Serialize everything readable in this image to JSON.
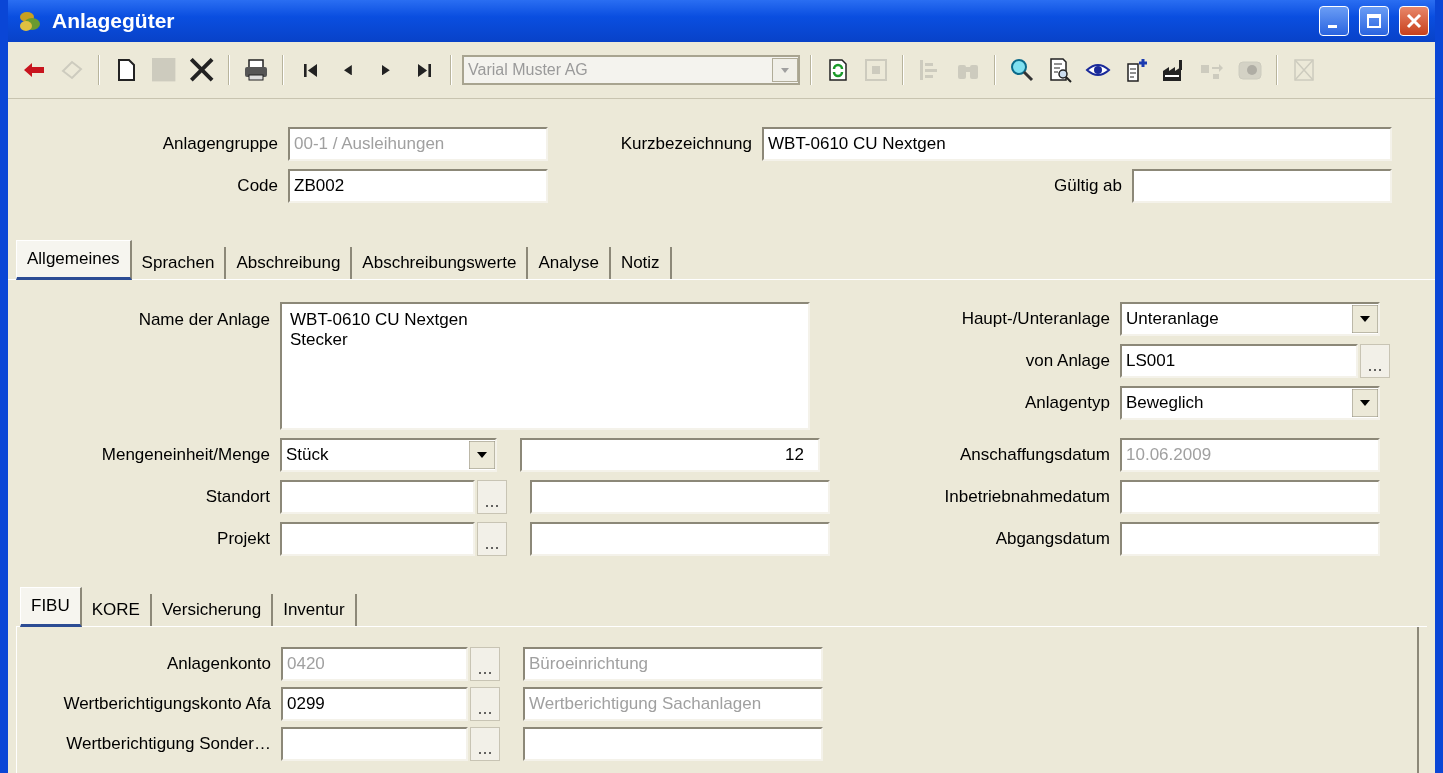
{
  "window": {
    "title": "Anlagegüter"
  },
  "toolbar": [
    {
      "kind": "back",
      "disabled": false
    },
    {
      "kind": "eraser",
      "disabled": true
    },
    {
      "kind": "separator"
    },
    {
      "kind": "new",
      "disabled": false
    },
    {
      "kind": "stop",
      "disabled": true
    },
    {
      "kind": "delete",
      "disabled": false
    },
    {
      "kind": "separator"
    },
    {
      "kind": "print",
      "disabled": false
    },
    {
      "kind": "separator"
    },
    {
      "kind": "first",
      "disabled": false
    },
    {
      "kind": "prev",
      "disabled": false
    },
    {
      "kind": "next",
      "disabled": false
    },
    {
      "kind": "last",
      "disabled": false
    },
    {
      "kind": "separator"
    },
    {
      "kind": "combo",
      "value": "Varial Muster AG",
      "disabled": true
    },
    {
      "kind": "separator"
    },
    {
      "kind": "refresh",
      "disabled": false
    },
    {
      "kind": "frame",
      "disabled": true
    },
    {
      "kind": "separator"
    },
    {
      "kind": "tree",
      "disabled": true
    },
    {
      "kind": "binoculars",
      "disabled": true
    },
    {
      "kind": "separator"
    },
    {
      "kind": "search",
      "disabled": false
    },
    {
      "kind": "docsearch",
      "disabled": false
    },
    {
      "kind": "eye",
      "disabled": false
    },
    {
      "kind": "docplus",
      "disabled": false
    },
    {
      "kind": "factory",
      "disabled": false
    },
    {
      "kind": "transfer",
      "disabled": true
    },
    {
      "kind": "camera",
      "disabled": true
    },
    {
      "kind": "separator"
    },
    {
      "kind": "boxx",
      "disabled": true
    }
  ],
  "header": {
    "anlagengruppe": {
      "label": "Anlagengruppe",
      "value": "00-1 / Ausleihungen",
      "disabled": true
    },
    "code": {
      "label": "Code",
      "value": "ZB002",
      "disabled": false
    },
    "kurzbezeichnung": {
      "label": "Kurzbezeichnung",
      "value": "WBT-0610 CU Nextgen",
      "disabled": false
    },
    "gueltig_ab": {
      "label": "Gültig ab"
    }
  },
  "tabs": [
    {
      "label": "Allgemeines",
      "selected": true
    },
    {
      "label": "Sprachen",
      "selected": false
    },
    {
      "label": "Abschreibung",
      "selected": false
    },
    {
      "label": "Abschreibungswerte",
      "selected": false
    },
    {
      "label": "Analyse",
      "selected": false
    },
    {
      "label": "Notiz",
      "selected": false
    }
  ],
  "general": {
    "name": {
      "label": "Name der Anlage",
      "value": "WBT-0610 CU Nextgen\nStecker"
    },
    "left_rows": [
      {
        "label": "Mengeneinheit/Menge",
        "kind": "dropdown",
        "value": "Stück",
        "second_field": {
          "kind": "number",
          "value": "12"
        }
      },
      {
        "label": "Standort",
        "kind": "lookup",
        "second_field": {
          "kind": "text"
        }
      },
      {
        "label": "Projekt",
        "kind": "lookup",
        "second_field": {
          "kind": "text"
        }
      }
    ],
    "right_rows": [
      {
        "label": "Haupt-/Unteranlage",
        "kind": "dropdown",
        "value": "Unteranlage",
        "disabled": false
      },
      {
        "label": "von Anlage",
        "kind": "lookup",
        "value": "LS001",
        "disabled": false
      },
      {
        "label": "Anlagentyp",
        "kind": "dropdown",
        "value": "Beweglich",
        "disabled": false
      },
      {
        "label": "Anschaffungsdatum",
        "kind": "text",
        "value": "10.06.2009",
        "disabled": true
      },
      {
        "label": "Inbetriebnahmedatum",
        "kind": "text"
      },
      {
        "label": "Abgangsdatum",
        "kind": "text"
      }
    ]
  },
  "subtabs": [
    {
      "label": "FIBU",
      "selected": true
    },
    {
      "label": "KORE",
      "selected": false
    },
    {
      "label": "Versicherung",
      "selected": false
    },
    {
      "label": "Inventur",
      "selected": false
    }
  ],
  "fibu_rows": [
    {
      "label": "Anlagenkonto",
      "account": "0420",
      "account_disabled": true,
      "description": "Büroeinrichtung",
      "description_disabled": true
    },
    {
      "label": "Wertberichtigungskonto Afa",
      "account": "0299",
      "account_disabled": false,
      "description": "Wertberichtigung Sachanlagen",
      "description_disabled": true
    },
    {
      "label": "Wertberichtigung Sonder…"
    }
  ]
}
